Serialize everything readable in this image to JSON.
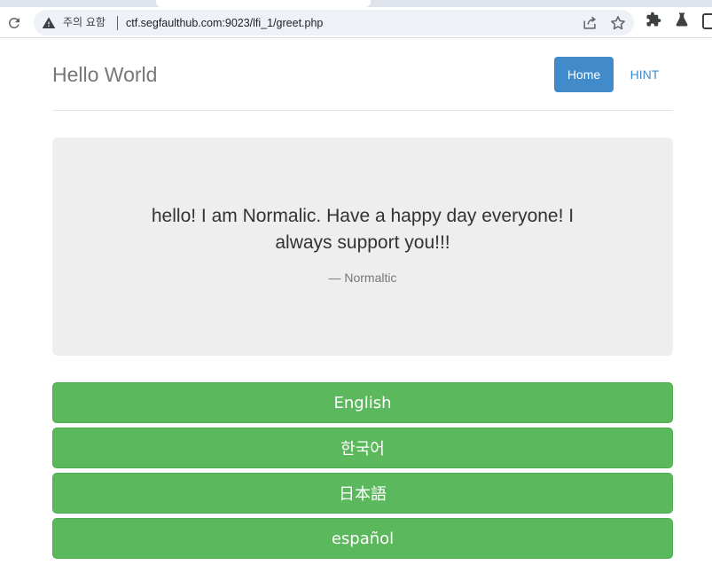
{
  "browser": {
    "security_warning": "주의 요함",
    "url": "ctf.segfaulthub.com:9023/lfi_1/greet.php",
    "icons": {
      "reload": "reload-icon",
      "warning": "warning-icon",
      "share": "share-icon",
      "bookmark": "star-icon",
      "extensions": "puzzle-icon",
      "labs": "flask-icon",
      "side_panel": "side-panel-icon"
    }
  },
  "header": {
    "title": "Hello World",
    "nav": {
      "home": "Home",
      "hint": "HINT"
    }
  },
  "quote": {
    "text": "hello! I am Normalic. Have a happy day everyone! I always support you!!!",
    "author": "— Normaltic"
  },
  "languages": [
    {
      "label": "English"
    },
    {
      "label": "한국어"
    },
    {
      "label": "日本語"
    },
    {
      "label": "español"
    }
  ],
  "colors": {
    "primary": "#428bca",
    "success": "#5cb85c",
    "jumbotron": "#eeeeee",
    "title": "#777777"
  }
}
